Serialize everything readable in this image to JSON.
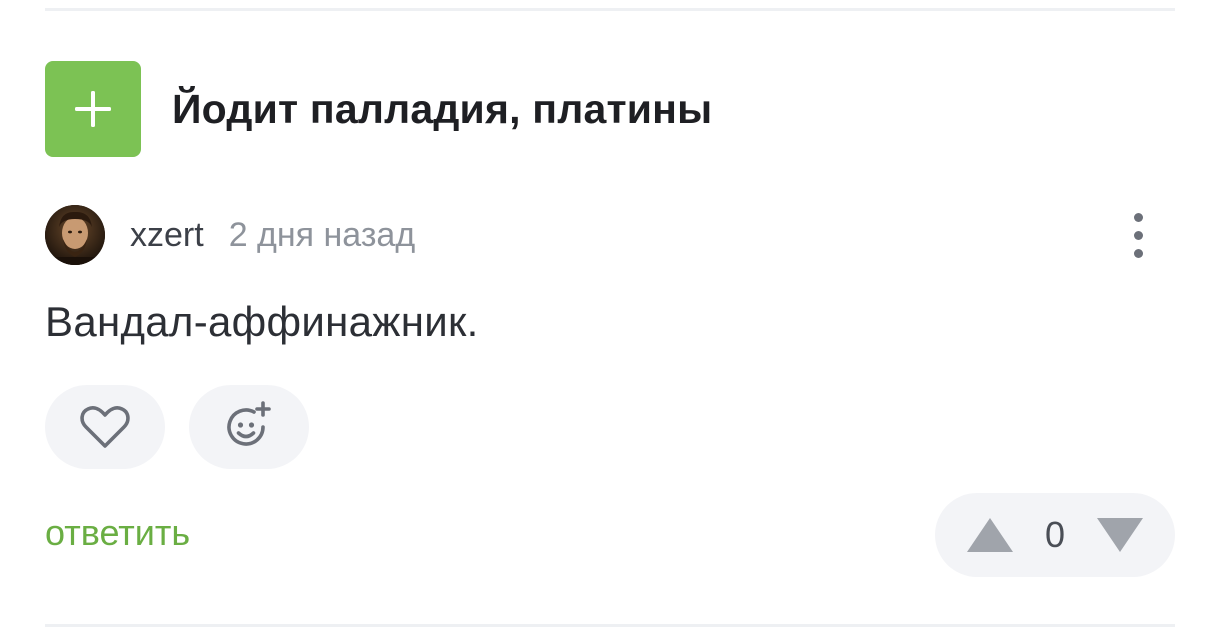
{
  "post": {
    "title": "Йодит палладия, платины"
  },
  "comment": {
    "author": "xzert",
    "time": "2 дня назад",
    "text": "Вандал-аффинажник.",
    "reply_label": "ответить",
    "rating": "0"
  },
  "icons": {
    "expand": "plus-icon",
    "more": "more-vertical-icon",
    "like": "heart-icon",
    "reaction": "smile-plus-icon",
    "upvote": "triangle-up-icon",
    "downvote": "triangle-down-icon"
  },
  "colors": {
    "accent_green": "#7cc254",
    "reply_green": "#6aae43",
    "pill_bg": "#f3f4f7",
    "icon_gray": "#6c7079",
    "arrow_gray": "#a0a4ab"
  }
}
